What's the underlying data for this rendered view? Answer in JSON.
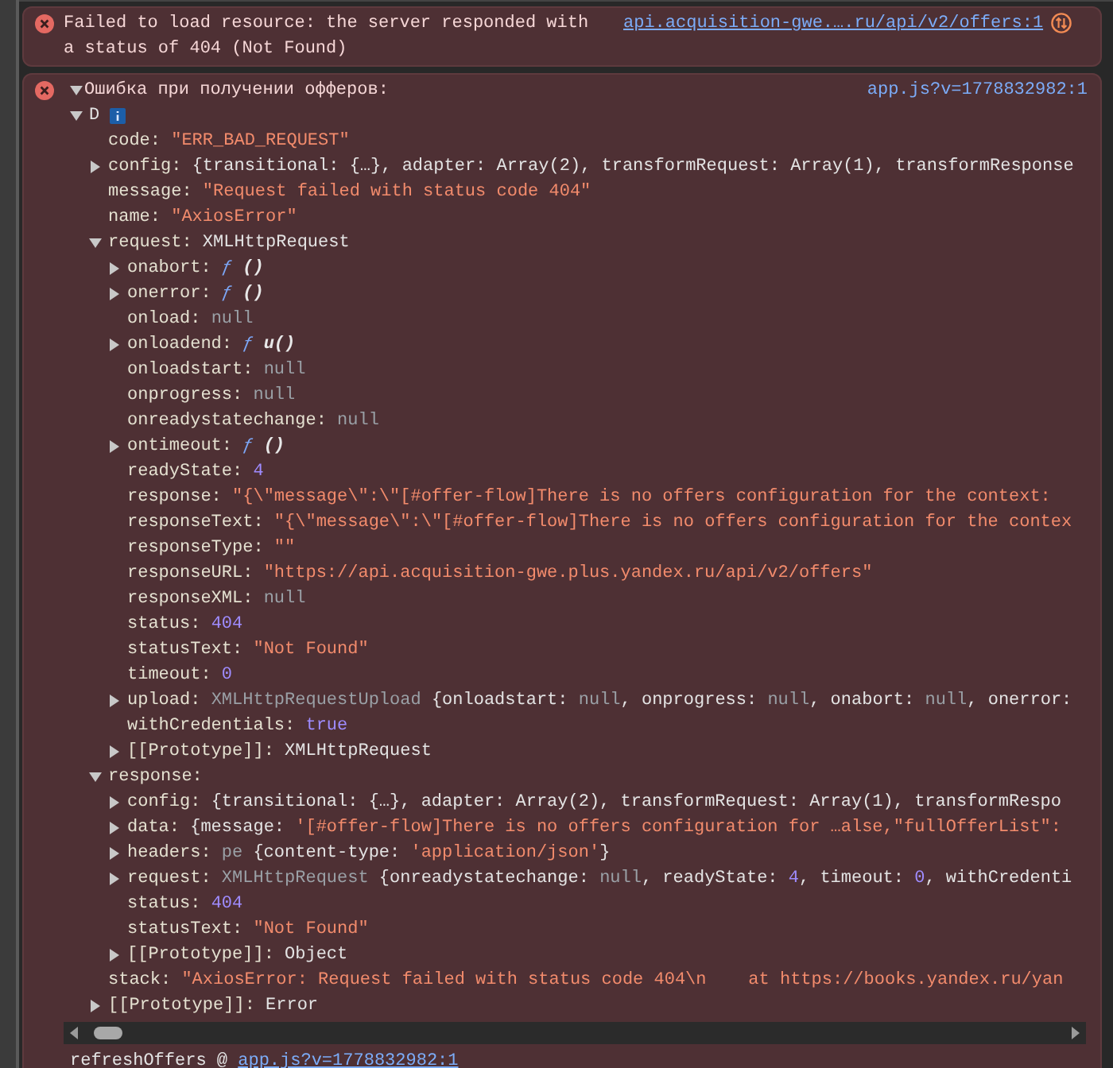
{
  "messages": [
    {
      "kind": "network",
      "text": "Failed to load resource: the server responded with a status of 404 (Not Found)",
      "link": "api.acquisition-gwe.….ru/api/v2/offers:1"
    },
    {
      "kind": "object",
      "text": "Ошибка при получении офферов:",
      "expanded": true,
      "link": "app.js?v=1778832982:1",
      "object": {
        "label": "D",
        "expanded": true,
        "children": [
          {
            "key": "code:",
            "value": [
              {
                "kind": "string",
                "text": "\"ERR_BAD_REQUEST\""
              }
            ]
          },
          {
            "key": "config:",
            "expanded": false,
            "value": [
              {
                "kind": "plain",
                "text": "{transitional: {…}, adapter: Array(2), transformRequest: Array(1), transformResponse"
              }
            ]
          },
          {
            "key": "message:",
            "value": [
              {
                "kind": "string",
                "text": "\"Request failed with status code 404\""
              }
            ]
          },
          {
            "key": "name:",
            "value": [
              {
                "kind": "string",
                "text": "\"AxiosError\""
              }
            ]
          },
          {
            "key": "request:",
            "expanded": true,
            "value": [
              {
                "kind": "plain",
                "text": "XMLHttpRequest"
              }
            ],
            "children": [
              {
                "key": "onabort:",
                "expanded": false,
                "value": [
                  {
                    "kind": "func",
                    "text": "ƒ"
                  },
                  {
                    "kind": "fname",
                    "text": "()"
                  }
                ]
              },
              {
                "key": "onerror:",
                "expanded": false,
                "value": [
                  {
                    "kind": "func",
                    "text": "ƒ"
                  },
                  {
                    "kind": "fname",
                    "text": "()"
                  }
                ]
              },
              {
                "key": "onload:",
                "value": [
                  {
                    "kind": "null",
                    "text": "null"
                  }
                ]
              },
              {
                "key": "onloadend:",
                "expanded": false,
                "value": [
                  {
                    "kind": "func",
                    "text": "ƒ"
                  },
                  {
                    "kind": "fname",
                    "text": "u()"
                  }
                ]
              },
              {
                "key": "onloadstart:",
                "value": [
                  {
                    "kind": "null",
                    "text": "null"
                  }
                ]
              },
              {
                "key": "onprogress:",
                "value": [
                  {
                    "kind": "null",
                    "text": "null"
                  }
                ]
              },
              {
                "key": "onreadystatechange:",
                "value": [
                  {
                    "kind": "null",
                    "text": "null"
                  }
                ]
              },
              {
                "key": "ontimeout:",
                "expanded": false,
                "value": [
                  {
                    "kind": "func",
                    "text": "ƒ"
                  },
                  {
                    "kind": "fname",
                    "text": "()"
                  }
                ]
              },
              {
                "key": "readyState:",
                "value": [
                  {
                    "kind": "number",
                    "text": "4"
                  }
                ]
              },
              {
                "key": "response:",
                "value": [
                  {
                    "kind": "string",
                    "text": "\"{\\\"message\\\":\\\"[#offer-flow]There is no offers configuration for the context:"
                  }
                ]
              },
              {
                "key": "responseText:",
                "value": [
                  {
                    "kind": "string",
                    "text": "\"{\\\"message\\\":\\\"[#offer-flow]There is no offers configuration for the contex"
                  }
                ]
              },
              {
                "key": "responseType:",
                "value": [
                  {
                    "kind": "string",
                    "text": "\"\""
                  }
                ]
              },
              {
                "key": "responseURL:",
                "value": [
                  {
                    "kind": "string",
                    "text": "\"https://api.acquisition-gwe.plus.yandex.ru/api/v2/offers\""
                  }
                ]
              },
              {
                "key": "responseXML:",
                "value": [
                  {
                    "kind": "null",
                    "text": "null"
                  }
                ]
              },
              {
                "key": "status:",
                "value": [
                  {
                    "kind": "number",
                    "text": "404"
                  }
                ]
              },
              {
                "key": "statusText:",
                "value": [
                  {
                    "kind": "string",
                    "text": "\"Not Found\""
                  }
                ]
              },
              {
                "key": "timeout:",
                "value": [
                  {
                    "kind": "number",
                    "text": "0"
                  }
                ]
              },
              {
                "key": "upload:",
                "expanded": false,
                "value": [
                  {
                    "kind": "class",
                    "text": "XMLHttpRequestUpload"
                  },
                  {
                    "kind": "plain",
                    "text": " {onloadstart: "
                  },
                  {
                    "kind": "null",
                    "text": "null"
                  },
                  {
                    "kind": "plain",
                    "text": ", onprogress: "
                  },
                  {
                    "kind": "null",
                    "text": "null"
                  },
                  {
                    "kind": "plain",
                    "text": ", onabort: "
                  },
                  {
                    "kind": "null",
                    "text": "null"
                  },
                  {
                    "kind": "plain",
                    "text": ", onerror:"
                  }
                ]
              },
              {
                "key": "withCredentials:",
                "value": [
                  {
                    "kind": "number",
                    "text": "true"
                  }
                ]
              },
              {
                "key": "[[Prototype]]:",
                "expanded": false,
                "value": [
                  {
                    "kind": "plain",
                    "text": "XMLHttpRequest"
                  }
                ]
              }
            ]
          },
          {
            "key": "response:",
            "expanded": true,
            "children": [
              {
                "key": "config:",
                "expanded": false,
                "value": [
                  {
                    "kind": "plain",
                    "text": "{transitional: {…}, adapter: Array(2), transformRequest: Array(1), transformRespo"
                  }
                ]
              },
              {
                "key": "data:",
                "expanded": false,
                "value": [
                  {
                    "kind": "plain",
                    "text": "{message: "
                  },
                  {
                    "kind": "string",
                    "text": "'[#offer-flow]There is no offers configuration for …alse,\"fullOfferList\":"
                  }
                ]
              },
              {
                "key": "headers:",
                "expanded": false,
                "value": [
                  {
                    "kind": "class",
                    "text": "pe"
                  },
                  {
                    "kind": "plain",
                    "text": " {content-type: "
                  },
                  {
                    "kind": "string",
                    "text": "'application/json'"
                  },
                  {
                    "kind": "plain",
                    "text": "}"
                  }
                ]
              },
              {
                "key": "request:",
                "expanded": false,
                "value": [
                  {
                    "kind": "class",
                    "text": "XMLHttpRequest"
                  },
                  {
                    "kind": "plain",
                    "text": " {onreadystatechange: "
                  },
                  {
                    "kind": "null",
                    "text": "null"
                  },
                  {
                    "kind": "plain",
                    "text": ", readyState: "
                  },
                  {
                    "kind": "number",
                    "text": "4"
                  },
                  {
                    "kind": "plain",
                    "text": ", timeout: "
                  },
                  {
                    "kind": "number",
                    "text": "0"
                  },
                  {
                    "kind": "plain",
                    "text": ", withCredenti"
                  }
                ]
              },
              {
                "key": "status:",
                "value": [
                  {
                    "kind": "number",
                    "text": "404"
                  }
                ]
              },
              {
                "key": "statusText:",
                "value": [
                  {
                    "kind": "string",
                    "text": "\"Not Found\""
                  }
                ]
              },
              {
                "key": "[[Prototype]]:",
                "expanded": false,
                "value": [
                  {
                    "kind": "plain",
                    "text": "Object"
                  }
                ]
              }
            ]
          },
          {
            "key": "stack:",
            "value": [
              {
                "kind": "string",
                "text": "\"AxiosError: Request failed with status code 404\\n    at https://books.yandex.ru/yan"
              }
            ]
          },
          {
            "key": "[[Prototype]]:",
            "expanded": false,
            "value": [
              {
                "kind": "plain",
                "text": "Error"
              }
            ]
          }
        ]
      },
      "stack_trace": [
        {
          "function": "refreshOffers",
          "separator": "@",
          "link": "app.js?v=1778832982:1"
        }
      ]
    }
  ]
}
